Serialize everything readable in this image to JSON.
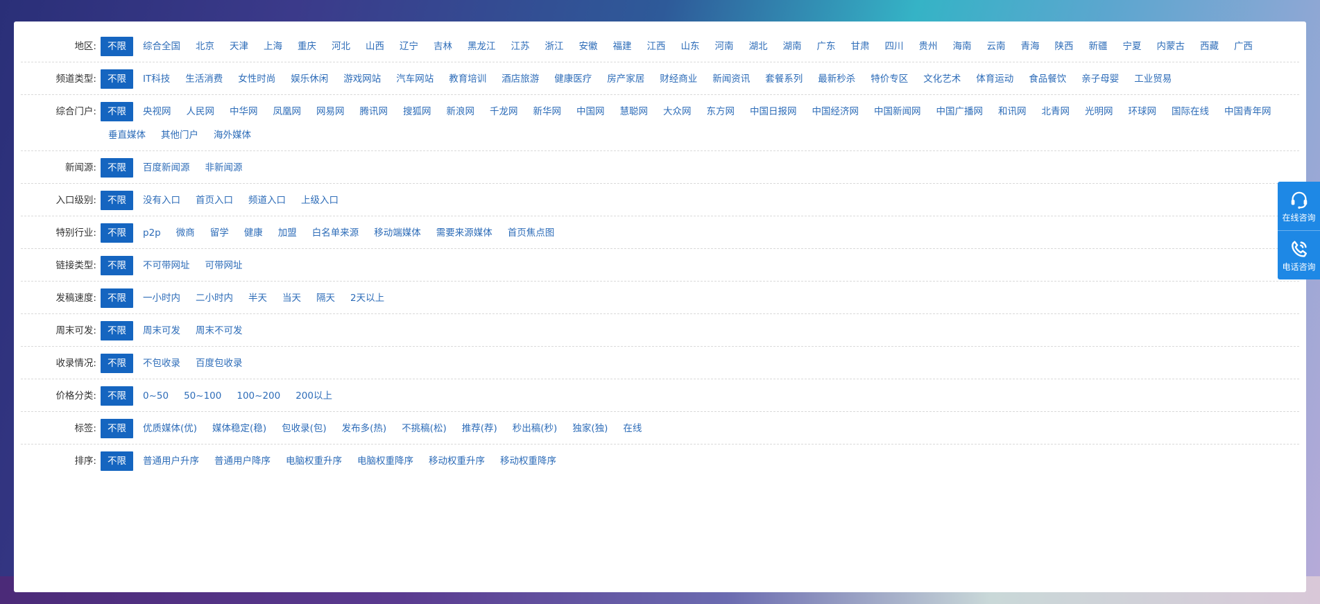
{
  "rows": [
    {
      "label": "地区:",
      "selected": "不限",
      "options": [
        "综合全国",
        "北京",
        "天津",
        "上海",
        "重庆",
        "河北",
        "山西",
        "辽宁",
        "吉林",
        "黑龙江",
        "江苏",
        "浙江",
        "安徽",
        "福建",
        "江西",
        "山东",
        "河南",
        "湖北",
        "湖南",
        "广东",
        "甘肃",
        "四川",
        "贵州",
        "海南",
        "云南",
        "青海",
        "陕西",
        "新疆",
        "宁夏",
        "内蒙古",
        "西藏",
        "广西"
      ]
    },
    {
      "label": "频道类型:",
      "selected": "不限",
      "options": [
        "IT科技",
        "生活消费",
        "女性时尚",
        "娱乐休闲",
        "游戏网站",
        "汽车网站",
        "教育培训",
        "酒店旅游",
        "健康医疗",
        "房产家居",
        "财经商业",
        "新闻资讯",
        "套餐系列",
        "最新秒杀",
        "特价专区",
        "文化艺术",
        "体育运动",
        "食品餐饮",
        "亲子母婴",
        "工业贸易"
      ]
    },
    {
      "label": "综合门户:",
      "selected": "不限",
      "options": [
        "央视网",
        "人民网",
        "中华网",
        "凤凰网",
        "网易网",
        "腾讯网",
        "搜狐网",
        "新浪网",
        "千龙网",
        "新华网",
        "中国网",
        "慧聪网",
        "大众网",
        "东方网",
        "中国日报网",
        "中国经济网",
        "中国新闻网",
        "中国广播网",
        "和讯网",
        "北青网",
        "光明网",
        "环球网",
        "国际在线",
        "中国青年网",
        "垂直媒体",
        "其他门户",
        "海外媒体"
      ]
    },
    {
      "label": "新闻源:",
      "selected": "不限",
      "options": [
        "百度新闻源",
        "非新闻源"
      ]
    },
    {
      "label": "入口级别:",
      "selected": "不限",
      "options": [
        "没有入口",
        "首页入口",
        "频道入口",
        "上级入口"
      ]
    },
    {
      "label": "特别行业:",
      "selected": "不限",
      "options": [
        "p2p",
        "微商",
        "留学",
        "健康",
        "加盟",
        "白名单来源",
        "移动端媒体",
        "需要来源媒体",
        "首页焦点图"
      ]
    },
    {
      "label": "链接类型:",
      "selected": "不限",
      "options": [
        "不可带网址",
        "可带网址"
      ]
    },
    {
      "label": "发稿速度:",
      "selected": "不限",
      "options": [
        "一小时内",
        "二小时内",
        "半天",
        "当天",
        "隔天",
        "2天以上"
      ]
    },
    {
      "label": "周末可发:",
      "selected": "不限",
      "options": [
        "周末可发",
        "周末不可发"
      ]
    },
    {
      "label": "收录情况:",
      "selected": "不限",
      "options": [
        "不包收录",
        "百度包收录"
      ]
    },
    {
      "label": "价格分类:",
      "selected": "不限",
      "options": [
        "0~50",
        "50~100",
        "100~200",
        "200以上"
      ]
    },
    {
      "label": "标签:",
      "selected": "不限",
      "options": [
        "优质媒体(优)",
        "媒体稳定(稳)",
        "包收录(包)",
        "发布多(热)",
        "不挑稿(松)",
        "推荐(荐)",
        "秒出稿(秒)",
        "独家(独)",
        "在线"
      ]
    },
    {
      "label": "排序:",
      "selected": "不限",
      "options": [
        "普通用户升序",
        "普通用户降序",
        "电脑权重升序",
        "电脑权重降序",
        "移动权重升序",
        "移动权重降序"
      ]
    }
  ],
  "float_bar": {
    "online": {
      "label": "在线咨询",
      "icon": "headset-icon"
    },
    "phone": {
      "label": "电话咨询",
      "icon": "phone-icon"
    }
  },
  "colors": {
    "accent": "#1565c0",
    "link": "#2d6cb8",
    "float": "#1e88e5"
  }
}
